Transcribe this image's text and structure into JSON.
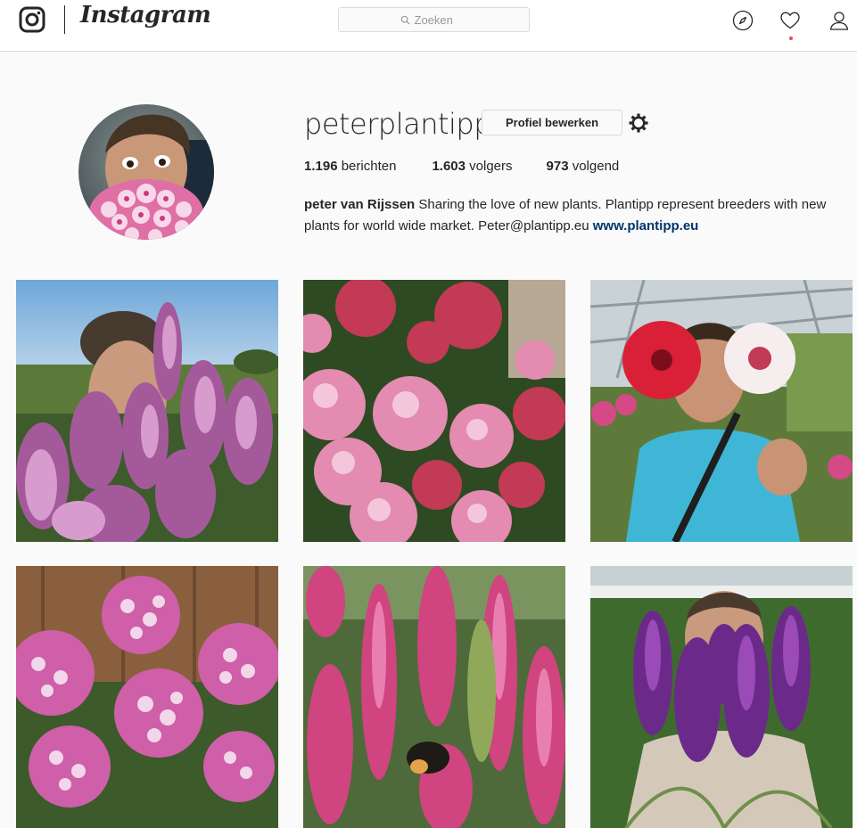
{
  "nav": {
    "logo_icon": "instagram-camera-icon",
    "wordmark": "Instagram",
    "search_placeholder": "Zoeken",
    "icons": [
      "compass-icon",
      "heart-icon",
      "person-icon"
    ],
    "notification_dot_color": "#ed4956"
  },
  "profile": {
    "username": "peterplantipp",
    "edit_label": "Profiel bewerken",
    "settings_icon": "gear-icon",
    "stats": {
      "posts_count": "1.196",
      "posts_label": "berichten",
      "followers_count": "1.603",
      "followers_label": "volgers",
      "following_count": "973",
      "following_label": "volgend"
    },
    "bio": {
      "full_name": "peter van Rijssen",
      "text": "Sharing the love of new plants. Plantipp represent breeders with new plants for world wide market. Peter@plantipp.eu",
      "link": "www.plantipp.eu"
    }
  },
  "colors": {
    "link": "#003569",
    "border": "#dbdbdb",
    "background": "#fafafa"
  }
}
